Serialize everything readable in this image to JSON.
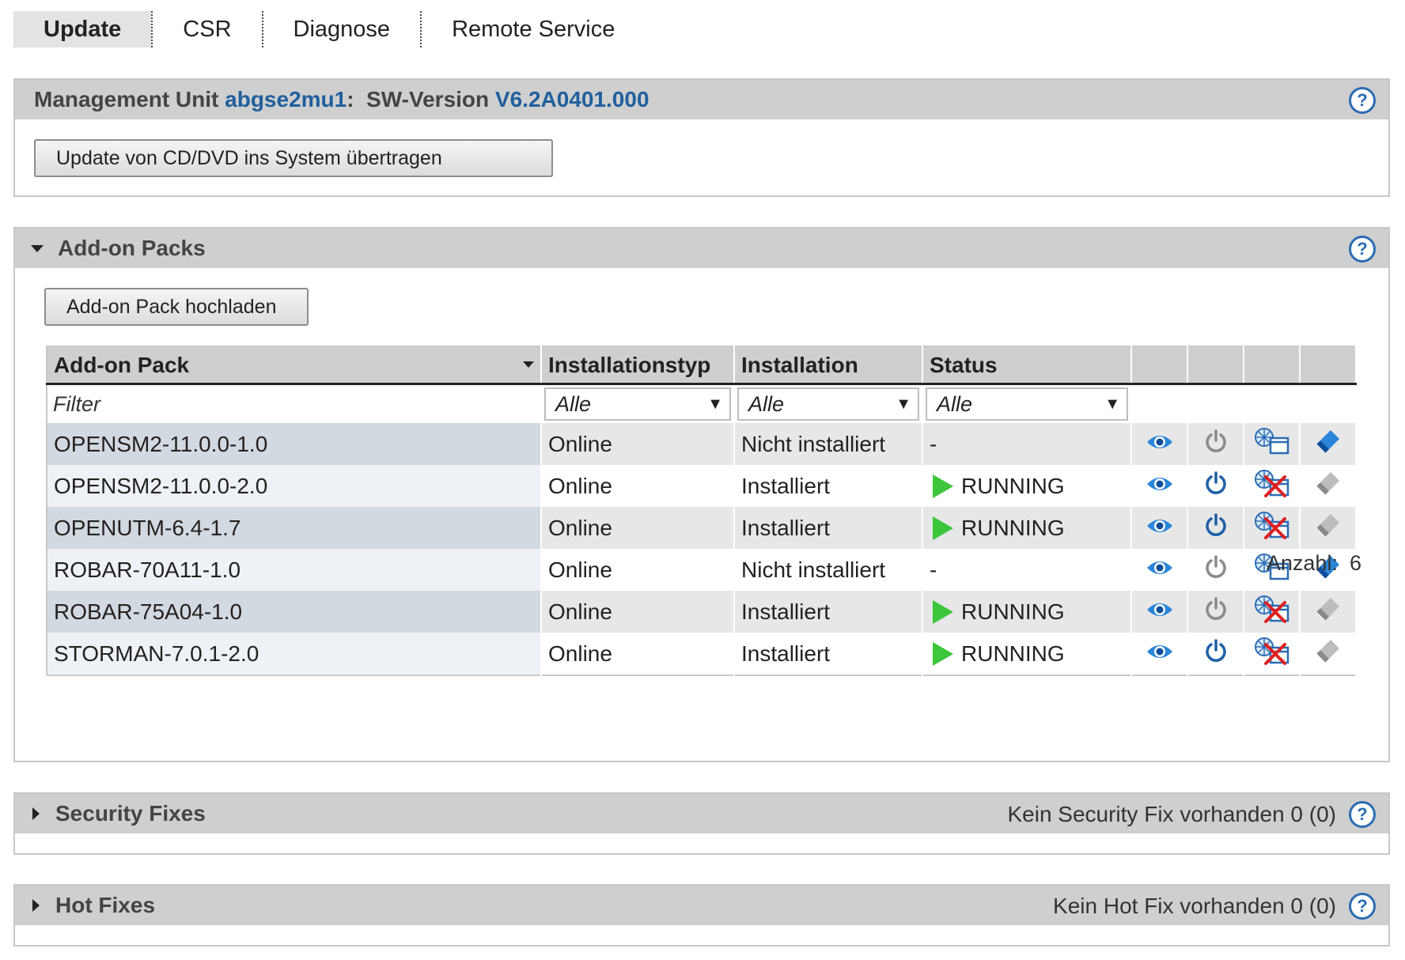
{
  "tabs": [
    {
      "label": "Update",
      "active": true
    },
    {
      "label": "CSR",
      "active": false
    },
    {
      "label": "Diagnose",
      "active": false
    },
    {
      "label": "Remote Service",
      "active": false
    }
  ],
  "mu_panel": {
    "prefix": "Management Unit",
    "unit_name": "abgse2mu1",
    "colon": ":",
    "sw_label": "SW-Version",
    "sw_version": "V6.2A0401.000",
    "help": "?",
    "button_label": "Update von CD/DVD ins System übertragen"
  },
  "addon_panel": {
    "title": "Add-on Packs",
    "help": "?",
    "upload_button": "Add-on Pack hochladen",
    "columns": [
      "Add-on Pack",
      "Installationstyp",
      "Installation",
      "Status"
    ],
    "filter_placeholder": "Filter",
    "filter_selects": [
      "Alle",
      "Alle",
      "Alle"
    ],
    "rows": [
      {
        "name": "OPENSM2-11.0.0-1.0",
        "type": "Online",
        "installation": "Nicht installiert",
        "status": "-",
        "running": false,
        "power_active": false,
        "uninstall": false,
        "install_active": true
      },
      {
        "name": "OPENSM2-11.0.0-2.0",
        "type": "Online",
        "installation": "Installiert",
        "status": "RUNNING",
        "running": true,
        "power_active": true,
        "uninstall": true,
        "install_active": false
      },
      {
        "name": "OPENUTM-6.4-1.7",
        "type": "Online",
        "installation": "Installiert",
        "status": "RUNNING",
        "running": true,
        "power_active": true,
        "uninstall": true,
        "install_active": false
      },
      {
        "name": "ROBAR-70A11-1.0",
        "type": "Online",
        "installation": "Nicht installiert",
        "status": "-",
        "running": false,
        "power_active": false,
        "uninstall": false,
        "install_active": true
      },
      {
        "name": "ROBAR-75A04-1.0",
        "type": "Online",
        "installation": "Installiert",
        "status": "RUNNING",
        "running": true,
        "power_active": false,
        "uninstall": true,
        "install_active": false
      },
      {
        "name": "STORMAN-7.0.1-2.0",
        "type": "Online",
        "installation": "Installiert",
        "status": "RUNNING",
        "running": true,
        "power_active": true,
        "uninstall": true,
        "install_active": false
      }
    ],
    "count_label": "Anzahl:",
    "count_value": "6"
  },
  "security_panel": {
    "title": "Security Fixes",
    "info": "Kein Security Fix vorhanden 0 (0)",
    "help": "?"
  },
  "hotfix_panel": {
    "title": "Hot Fixes",
    "info": "Kein Hot Fix vorhanden 0 (0)",
    "help": "?"
  },
  "colors": {
    "accent_blue": "#1f5f9e",
    "running_green": "#3cc63c",
    "uninstall_red": "#e02020",
    "header_gray": "#cfcfcf"
  },
  "icons": [
    "eye-icon",
    "power-icon",
    "install-icon",
    "uninstall-icon",
    "eraser-icon",
    "play-icon",
    "help-icon"
  ]
}
